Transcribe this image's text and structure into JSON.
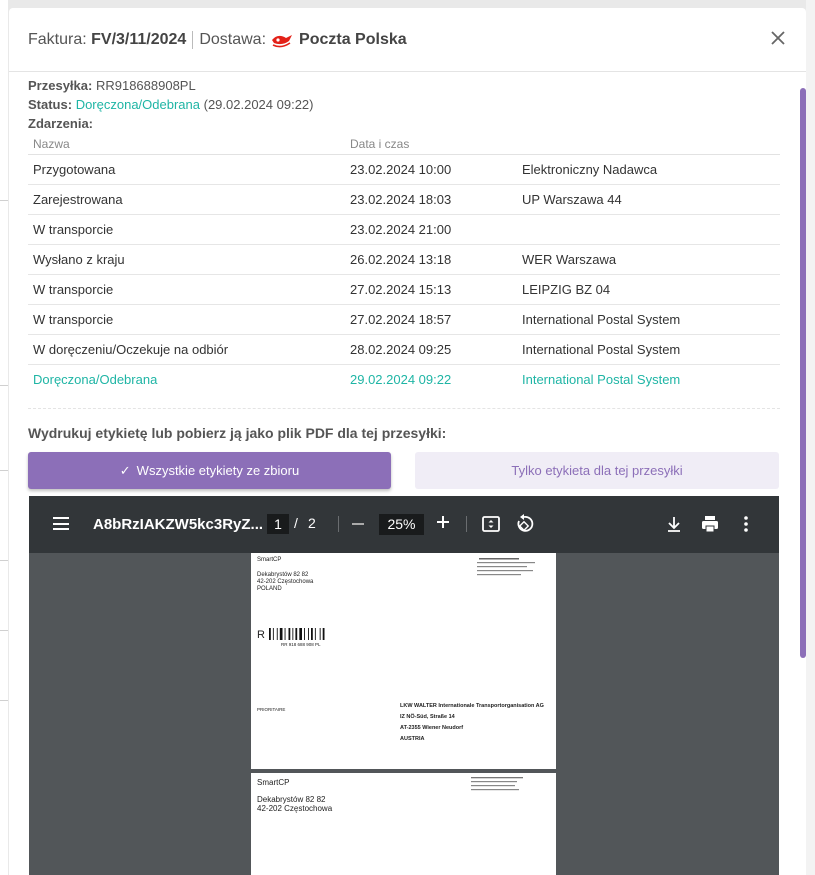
{
  "header": {
    "invoice_label": "Faktura:",
    "invoice_number": "FV/3/11/2024",
    "delivery_label": "Dostawa:",
    "carrier_name": "Poczta Polska",
    "carrier_logo_icon": "poczta-polska-logo"
  },
  "shipment": {
    "parcel_label": "Przesyłka:",
    "parcel_number": "RR918688908PL",
    "status_label": "Status:",
    "status_value": "Doręczona/Odebrana",
    "status_date": "(29.02.2024 09:22)",
    "events_label": "Zdarzenia:"
  },
  "events_table": {
    "columns": [
      "Nazwa",
      "Data i czas",
      ""
    ],
    "rows": [
      {
        "name": "Przygotowana",
        "datetime": "23.02.2024 10:00",
        "location": "Elektroniczny Nadawca"
      },
      {
        "name": "Zarejestrowana",
        "datetime": "23.02.2024 18:03",
        "location": "UP Warszawa 44"
      },
      {
        "name": "W transporcie",
        "datetime": "23.02.2024 21:00",
        "location": ""
      },
      {
        "name": "Wysłano z kraju",
        "datetime": "26.02.2024 13:18",
        "location": "WER Warszawa"
      },
      {
        "name": "W transporcie",
        "datetime": "27.02.2024 15:13",
        "location": "LEIPZIG BZ 04"
      },
      {
        "name": "W transporcie",
        "datetime": "27.02.2024 18:57",
        "location": "International Postal System"
      },
      {
        "name": "W doręczeniu/Oczekuje na odbiór",
        "datetime": "28.02.2024 09:25",
        "location": "International Postal System"
      },
      {
        "name": "Doręczona/Odebrana",
        "datetime": "29.02.2024 09:22",
        "location": "International Postal System"
      }
    ]
  },
  "print_section": {
    "title": "Wydrukuj etykietę lub pobierz ją jako plik PDF dla tej przesyłki:",
    "all_labels_button": "Wszystkie etykiety ze zbioru",
    "single_label_button": "Tylko etykieta dla tej przesyłki"
  },
  "pdf_viewer": {
    "file_name": "A8bRzIAKZW5kc3RyZ...",
    "current_page": "1",
    "page_separator": "/",
    "total_pages": "2",
    "zoom": "25%",
    "icons": [
      "menu-icon",
      "zoom-out-icon",
      "zoom-in-icon",
      "fit-page-icon",
      "rotate-icon",
      "download-icon",
      "print-icon",
      "more-icon"
    ]
  },
  "label_page1": {
    "sender_company": "SmartCP",
    "sender_street": "Dekabrystów 82 82",
    "sender_city": "42-202 Częstochowa",
    "sender_country": "POLAND",
    "barcode_prefix": "R",
    "barcode_text": "RR 918 688 908 PL",
    "priority": "PRIORITAIRE",
    "recipient_company": "LKW WALTER Internationale Transportorganisation AG",
    "recipient_street": "IZ NÖ-Süd, Straße 14",
    "recipient_city": "AT-2355 Wiener Neudorf",
    "recipient_country": "AUSTRIA"
  },
  "label_page2": {
    "sender_company": "SmartCP",
    "sender_street": "Dekabrystów 82 82",
    "sender_city": "42-202 Częstochowa"
  }
}
